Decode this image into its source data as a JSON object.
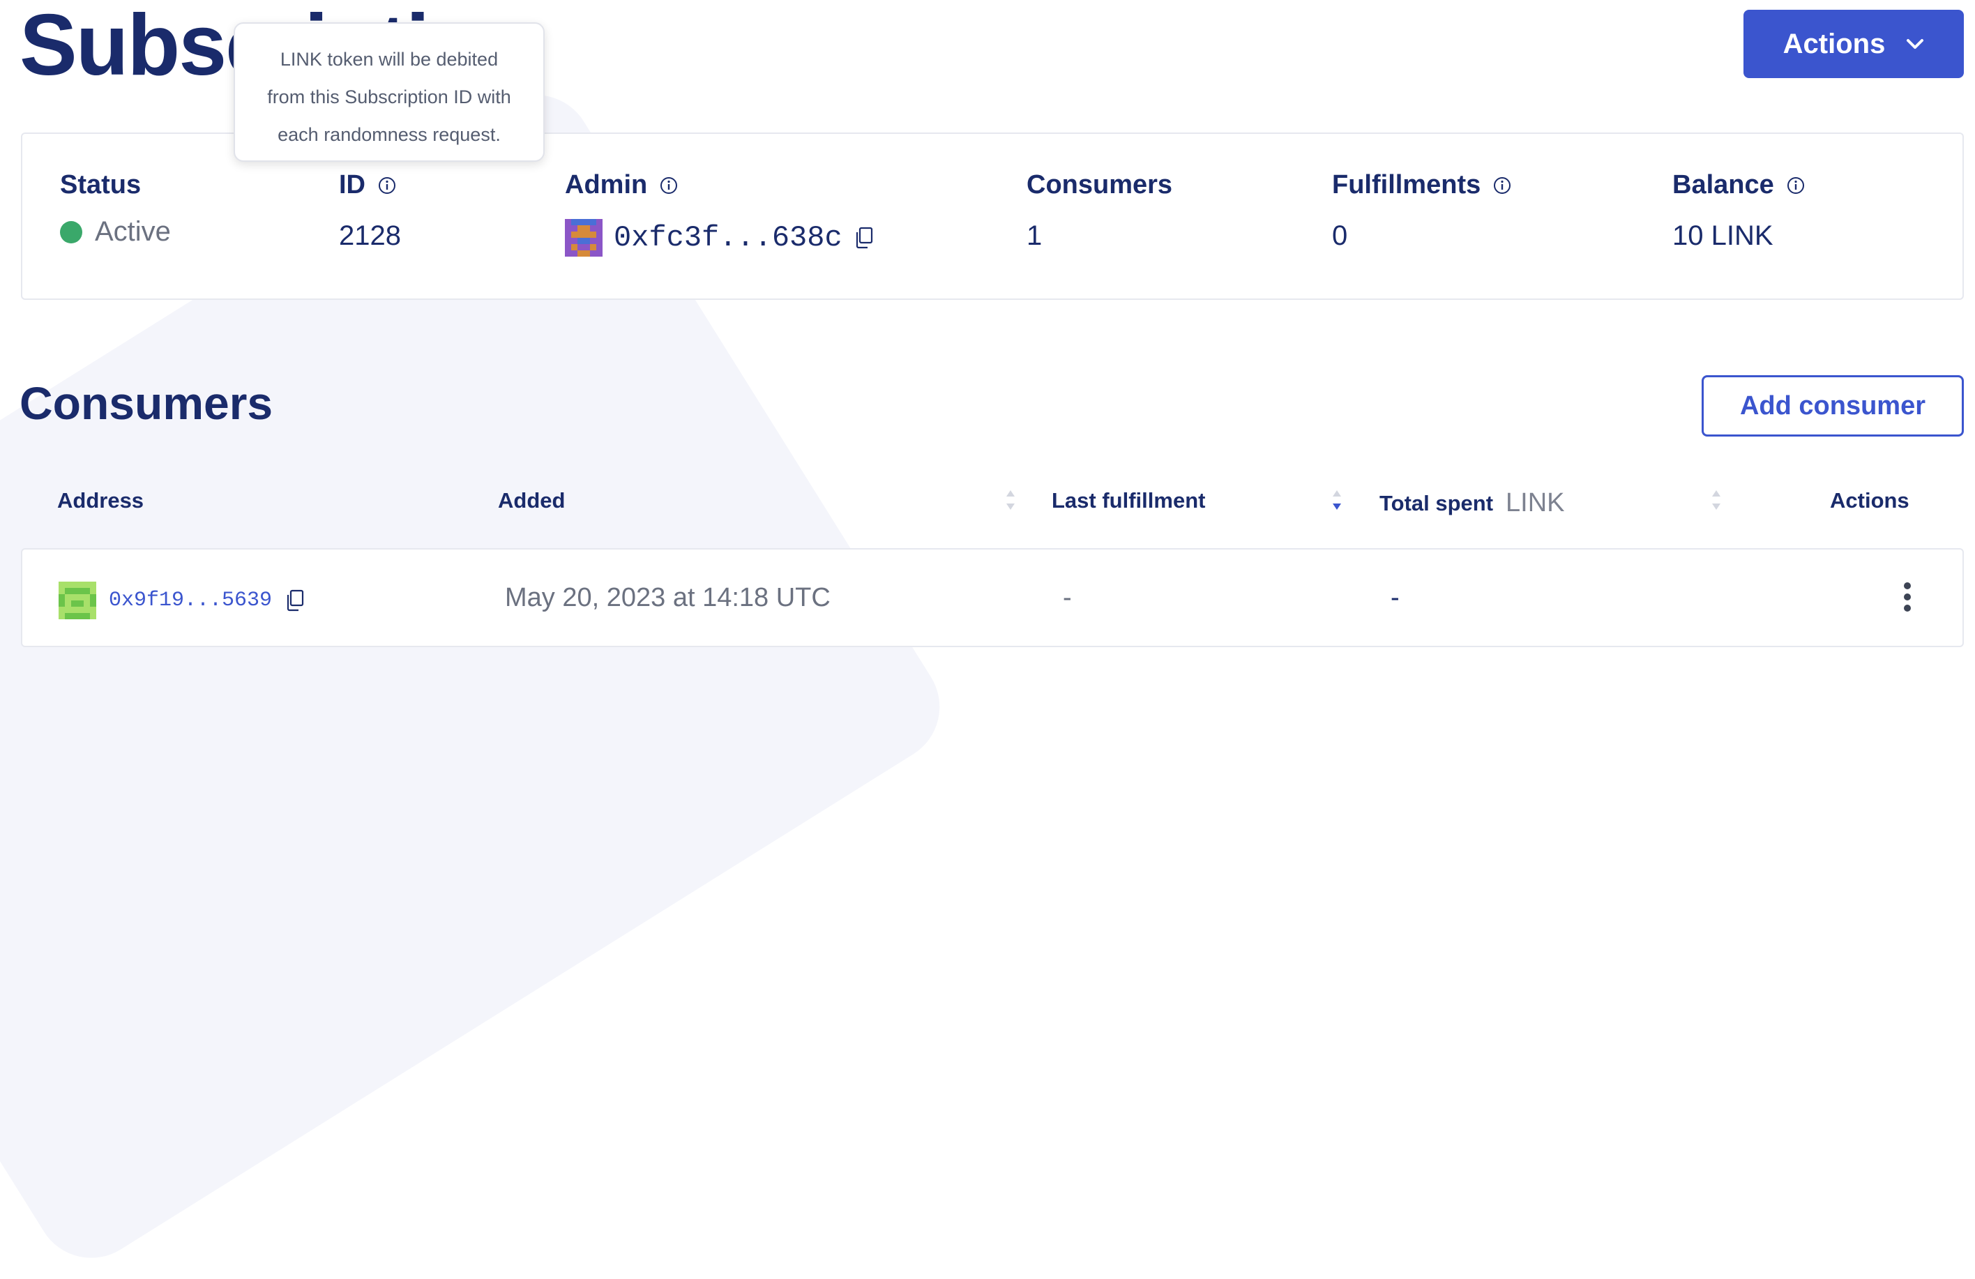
{
  "header": {
    "title": "Subscription",
    "actions_label": "Actions"
  },
  "tooltip": {
    "lines": [
      "LINK token will be debited",
      "from this Subscription ID with",
      "each randomness request."
    ]
  },
  "summary": {
    "status": {
      "label": "Status",
      "value": "Active",
      "color": "#3aa86a"
    },
    "id": {
      "label": "ID",
      "value": "2128"
    },
    "admin": {
      "label": "Admin",
      "value": "0xfc3f...638c"
    },
    "consumers": {
      "label": "Consumers",
      "value": "1"
    },
    "fulfillments": {
      "label": "Fulfillments",
      "value": "0"
    },
    "balance": {
      "label": "Balance",
      "value": "10 LINK"
    }
  },
  "consumers_section": {
    "title": "Consumers",
    "add_label": "Add consumer",
    "columns": {
      "address": "Address",
      "added": "Added",
      "last_fulfillment": "Last fulfillment",
      "total_spent": "Total spent",
      "total_spent_unit": "LINK",
      "actions": "Actions"
    },
    "rows": [
      {
        "address": "0x9f19...5639",
        "added": "May 20, 2023 at 14:18 UTC",
        "last_fulfillment": "-",
        "total_spent": "-"
      }
    ]
  },
  "colors": {
    "primary": "#3b55ce",
    "navy": "#1a2b6b",
    "active": "#3aa86a"
  }
}
